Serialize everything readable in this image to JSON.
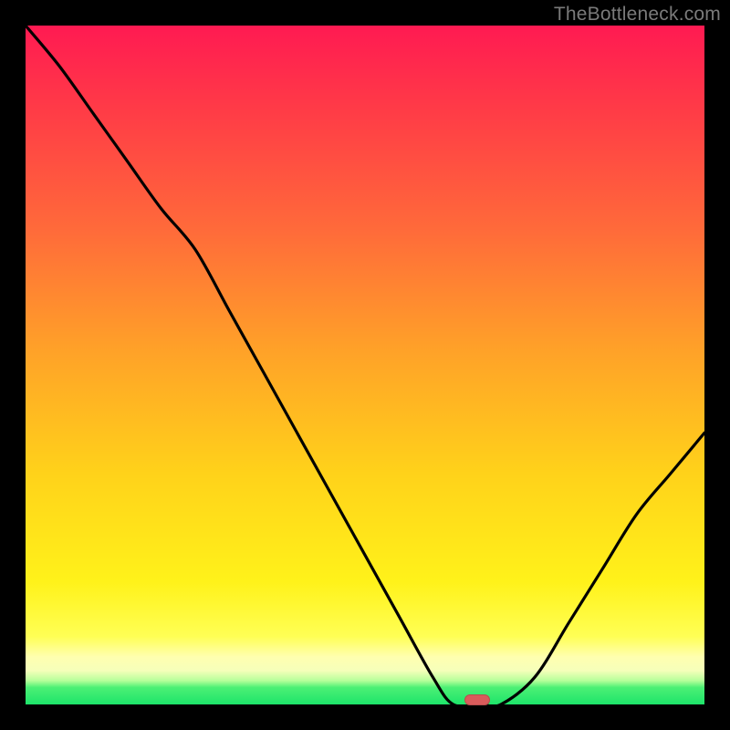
{
  "watermark": "TheBottleneck.com",
  "chart_data": {
    "type": "line",
    "title": "",
    "xlabel": "",
    "ylabel": "",
    "x": [
      0.0,
      0.05,
      0.1,
      0.15,
      0.2,
      0.25,
      0.3,
      0.35,
      0.4,
      0.45,
      0.5,
      0.55,
      0.6,
      0.63,
      0.67,
      0.7,
      0.75,
      0.8,
      0.85,
      0.9,
      0.95,
      1.0
    ],
    "values": [
      1.0,
      0.94,
      0.87,
      0.8,
      0.73,
      0.67,
      0.58,
      0.49,
      0.4,
      0.31,
      0.22,
      0.13,
      0.04,
      0.0,
      0.0,
      0.0,
      0.04,
      0.12,
      0.2,
      0.28,
      0.34,
      0.4
    ],
    "xlim": [
      0,
      1
    ],
    "ylim": [
      0,
      1
    ],
    "marker": {
      "x": 0.665,
      "y": 0.0
    },
    "notes": "x and y are normalized fractions of the plot area; y=1 at top (red), y=0 at bottom (green). Curve descends from top-left, flattens near x≈0.63–0.70 at y≈0, then rises toward the right edge reaching y≈0.40 at x=1."
  },
  "colors": {
    "curve": "#000000",
    "marker": "#d95b5b",
    "background_top": "#ff1a52",
    "background_bottom": "#1de46a"
  }
}
